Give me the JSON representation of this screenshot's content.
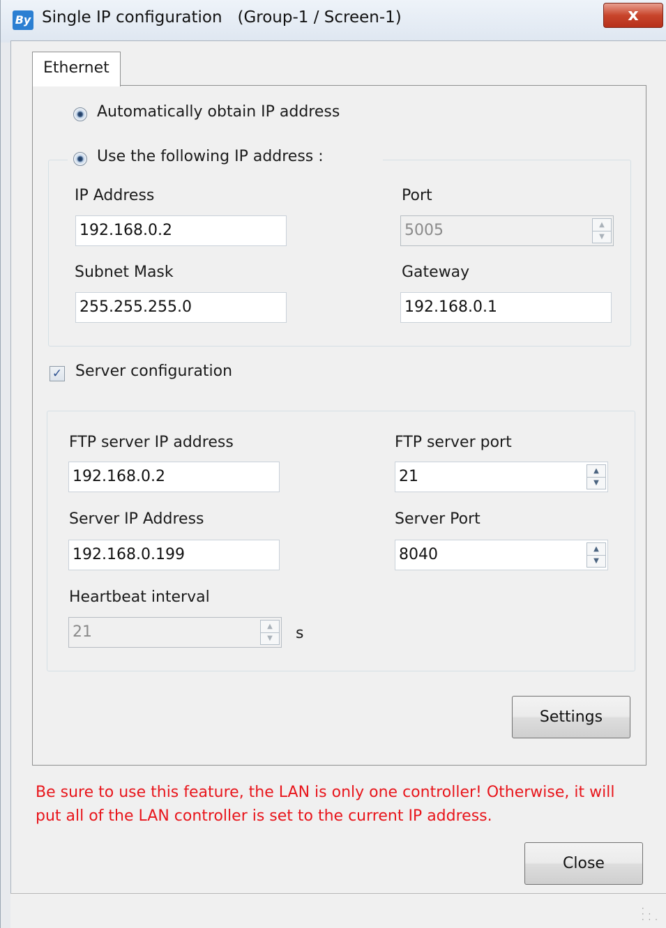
{
  "window": {
    "app_icon_text": "By",
    "title": "Single IP configuration   (Group-1 / Screen-1)",
    "close_glyph": "x"
  },
  "tabs": [
    {
      "label": "Ethernet",
      "selected": true
    }
  ],
  "ip_mode": {
    "auto_label": "Automatically obtain IP address",
    "manual_label": "Use the following IP address :"
  },
  "ethernet": {
    "ip_address_label": "IP Address",
    "ip_address_value": "192.168.0.2",
    "port_label": "Port",
    "port_value": "5005",
    "subnet_label": "Subnet Mask",
    "subnet_value": "255.255.255.0",
    "gateway_label": "Gateway",
    "gateway_value": "192.168.0.1"
  },
  "server": {
    "checkbox_label": "Server configuration",
    "checked": true,
    "ftp_ip_label": "FTP server IP address",
    "ftp_ip_value": "192.168.0.2",
    "ftp_port_label": "FTP server port",
    "ftp_port_value": "21",
    "server_ip_label": "Server IP Address",
    "server_ip_value": "192.168.0.199",
    "server_port_label": "Server Port",
    "server_port_value": "8040",
    "heartbeat_label": "Heartbeat interval",
    "heartbeat_value": "21",
    "heartbeat_unit": "s"
  },
  "buttons": {
    "settings": "Settings",
    "close": "Close"
  },
  "warning_text": "Be sure to use this feature, the LAN is only one controller! Otherwise, it will put all of the LAN controller is set to the current IP address.",
  "colors": {
    "warning": "#e8151b",
    "title_close": "#c8452c"
  }
}
